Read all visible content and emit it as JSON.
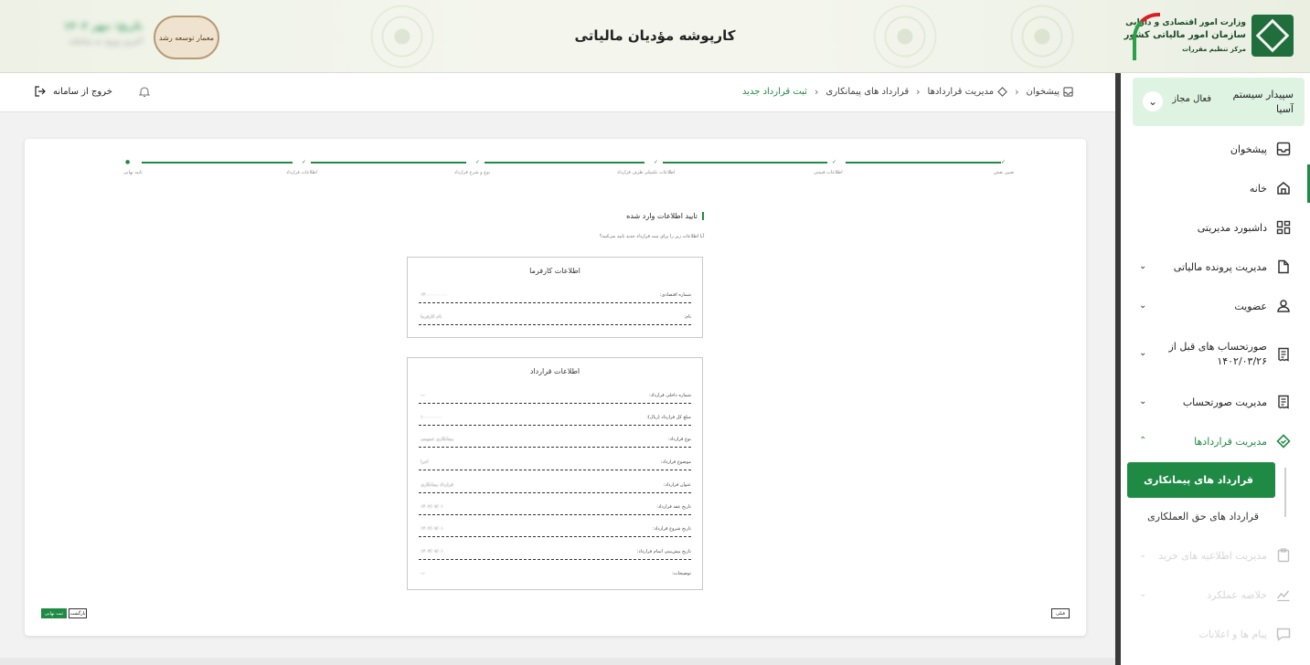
{
  "header": {
    "app_title": "کارپوشه مؤدیان مالیاتی",
    "ministry_line1": "وزارت امور اقتصادی و دارایی",
    "ministry_line2": "سازمان امور مالیاتی کشور",
    "ministry_line3": "مرکز تنظیم مقررات",
    "brand_seal": "معمار توسعه رشد",
    "blur_line1": "تاریخ: مهر ۱۴۰۲",
    "blur_line2": "آخرین ورود به سامانه"
  },
  "user": {
    "name": "سپیدار سیستم آسیا",
    "status": "فعال مجاز"
  },
  "sidebar": {
    "items": [
      {
        "label": "پیشخوان",
        "icon": "inbox-icon"
      },
      {
        "label": "خانه",
        "icon": "home-icon"
      },
      {
        "label": "داشبورد مدیریتی",
        "icon": "dashboard-icon"
      },
      {
        "label": "مدیریت پرونده مالیاتی",
        "icon": "document-icon"
      },
      {
        "label": "عضویت",
        "icon": "user-icon"
      },
      {
        "label": "صورتحساب های قبل از ۱۴۰۲/۰۳/۲۶",
        "icon": "receipt-icon"
      },
      {
        "label": "مدیریت صورتحساب",
        "icon": "receipt-icon"
      },
      {
        "label": "مدیریت قراردادها",
        "icon": "contract-icon"
      },
      {
        "label": "مدیریت اطلاعیه های خرید",
        "icon": "clipboard-icon"
      },
      {
        "label": "خلاصه عملکرد",
        "icon": "chart-icon"
      },
      {
        "label": "پیام ها و اعلانات",
        "icon": "message-icon"
      }
    ],
    "sub_items": [
      {
        "label": "قرارداد های پیمانکاری"
      },
      {
        "label": "قرارداد های حق العملکاری"
      }
    ]
  },
  "toolbar": {
    "breadcrumb": [
      "پیشخوان",
      "مدیریت قراردادها",
      "قرارداد های پیمانکاری",
      "ثبت قرارداد جدید"
    ],
    "logout_label": "خروج از سامانه"
  },
  "form": {
    "steps": [
      "تعیین نقش",
      "اطلاعات قیمتی",
      "اطلاعات تکمیلی طرف قرارداد",
      "نوع و شرح قرارداد",
      "اطلاعات قرارداد",
      "تایید نهایی"
    ],
    "confirm_title": "تایید اطلاعات وارد شده",
    "confirm_sub": "آیا اطلاعات زیر را برای ثبت قرارداد جدید تایید می‌کنید؟",
    "employer_panel": {
      "title": "اطلاعات کارفرما",
      "fields": [
        {
          "label": "شماره اقتصادی:",
          "value": "۱۴۰۰۰۰۰۰۰۰۰"
        },
        {
          "label": "نام:",
          "value": "نام کارفرما"
        }
      ]
    },
    "contract_panel": {
      "title": "اطلاعات قرارداد",
      "fields": [
        {
          "label": "شماره داخلی قرارداد:",
          "value": "—"
        },
        {
          "label": "مبلغ کل قرارداد (ریال):",
          "value": "۱۰۰۰۰۰۰۰۰"
        },
        {
          "label": "نوع قرارداد:",
          "value": "پیمانکاری عمومی"
        },
        {
          "label": "موضوع قرارداد:",
          "value": "اجرا"
        },
        {
          "label": "عنوان قرارداد:",
          "value": "قرارداد پیمانکاری"
        },
        {
          "label": "تاریخ عقد قرارداد:",
          "value": "۱۴۰۲/۰۷/۰۱"
        },
        {
          "label": "تاریخ شروع قرارداد:",
          "value": "۱۴۰۲/۰۷/۰۱"
        },
        {
          "label": "تاریخ پیش‌بینی اتمام قرارداد:",
          "value": "۱۴۰۳/۰۷/۰۱"
        },
        {
          "label": "توضیحات:",
          "value": "—"
        }
      ]
    },
    "btn_prev": "قبلی",
    "btn_back": "بازگشت",
    "btn_submit": "ثبت نهایی"
  },
  "colors": {
    "accent": "#1f8a44",
    "accent_light": "#dff3e3"
  }
}
